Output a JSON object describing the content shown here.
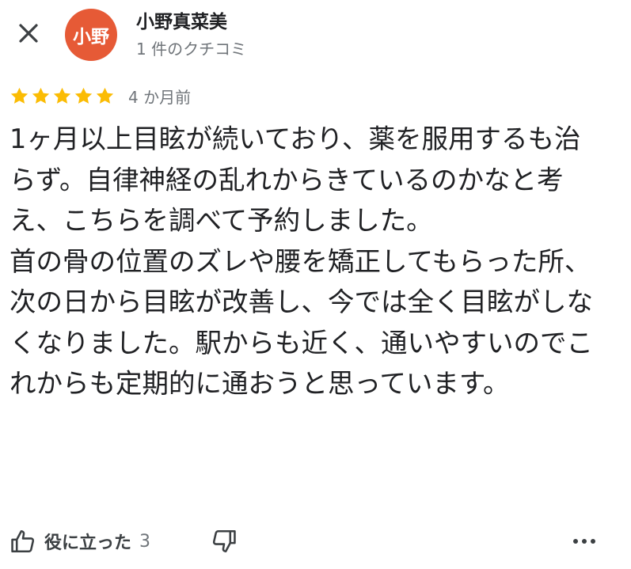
{
  "header": {
    "close_icon": "close-icon",
    "avatar": {
      "initials": "小野",
      "bg_color": "#e65a36"
    },
    "author_name": "小野真菜美",
    "review_count": "1 件のクチコミ"
  },
  "review": {
    "rating": 5,
    "max_rating": 5,
    "star_color": "#fbbc04",
    "time": "4 か月前",
    "text": "1ヶ月以上目眩が続いており、薬を服用するも治らず。自律神経の乱れからきているのかなと考え、こちらを調べて予約しました。\n首の骨の位置のズレや腰を矯正してもらった所、次の日から目眩が改善し、今では全く目眩がしなくなりました。駅からも近く、通いやすいのでこれからも定期的に通おうと思っています。"
  },
  "actions": {
    "helpful_label": "役に立った",
    "helpful_count": "3",
    "like_icon": "thumbs-up-icon",
    "dislike_icon": "thumbs-down-icon",
    "more_icon": "more-horizontal-icon"
  }
}
